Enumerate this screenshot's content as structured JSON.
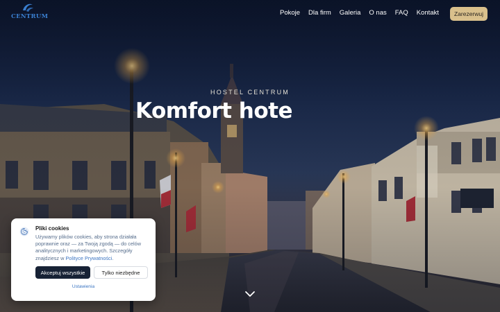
{
  "header": {
    "logo_text": "CENTRUM",
    "nav": [
      {
        "label": "Pokoje"
      },
      {
        "label": "Dla firm"
      },
      {
        "label": "Galeria"
      },
      {
        "label": "O nas"
      },
      {
        "label": "FAQ"
      },
      {
        "label": "Kontakt"
      }
    ],
    "book_label": "Zarezerwuj"
  },
  "hero": {
    "eyebrow": "HOSTEL CENTRUM",
    "headline": "Komfort hote",
    "scroll_icon": "chevron-down-icon"
  },
  "cookie": {
    "icon": "cookie-icon",
    "title": "Pliki cookies",
    "body_text": "Używamy plików cookies, aby strona działała poprawnie oraz — za Twoją zgodą — do celów analitycznych i marketingowych. Szczegóły znajdziesz w ",
    "policy_link": "Polityce Prywatności",
    "body_end": ".",
    "accept_all": "Akceptuj wszystkie",
    "only_necessary": "Tylko niezbędne",
    "settings": "Ustawienia"
  },
  "colors": {
    "accent_button": "#d9c08c",
    "dark_button": "#172235",
    "link": "#3a74c2",
    "logo": "#3a7fd0"
  }
}
